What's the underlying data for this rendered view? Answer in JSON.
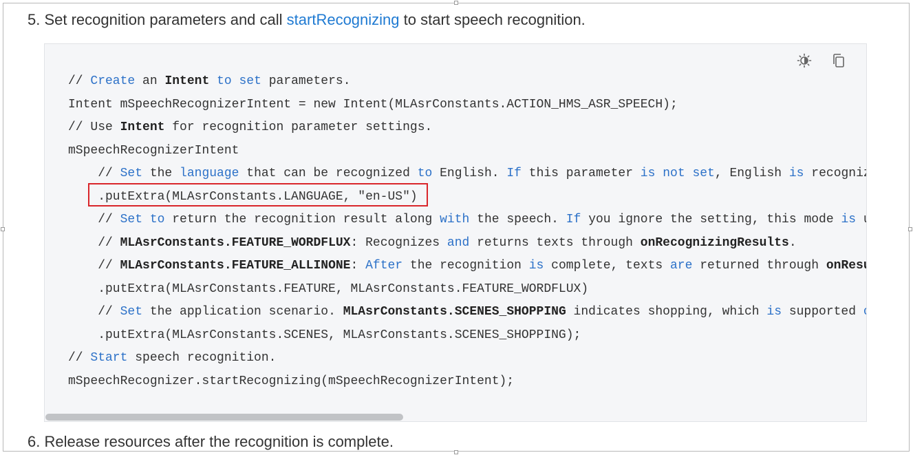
{
  "steps": {
    "step5": {
      "prefix": "5. Set recognition parameters and call ",
      "link": "startRecognizing",
      "suffix": " to start speech recognition."
    },
    "step6": "6. Release resources after the recognition is complete."
  },
  "code_block": {
    "toolbar": {
      "theme_icon": "theme-toggle-icon",
      "copy_icon": "copy-icon"
    },
    "lines": [
      [
        [
          "c",
          "// "
        ],
        [
          "k",
          "Create"
        ],
        [
          "c",
          " an "
        ],
        [
          "b",
          "Intent"
        ],
        [
          "c",
          " "
        ],
        [
          "k",
          "to"
        ],
        [
          "c",
          " "
        ],
        [
          "k",
          "set"
        ],
        [
          "c",
          " parameters."
        ]
      ],
      [
        [
          "n",
          "Intent mSpeechRecognizerIntent = new Intent(MLAsrConstants.ACTION_HMS_ASR_SPEECH);"
        ]
      ],
      [
        [
          "c",
          "// Use "
        ],
        [
          "b",
          "Intent"
        ],
        [
          "c",
          " for recognition parameter settings."
        ]
      ],
      [
        [
          "n",
          "mSpeechRecognizerIntent"
        ]
      ],
      [
        [
          "c",
          "    // "
        ],
        [
          "k",
          "Set"
        ],
        [
          "c",
          " the "
        ],
        [
          "k",
          "language"
        ],
        [
          "c",
          " that can be recognized "
        ],
        [
          "k",
          "to"
        ],
        [
          "c",
          " English. "
        ],
        [
          "k",
          "If"
        ],
        [
          "c",
          " this parameter "
        ],
        [
          "k",
          "is"
        ],
        [
          "c",
          " "
        ],
        [
          "k",
          "not"
        ],
        [
          "c",
          " "
        ],
        [
          "k",
          "set"
        ],
        [
          "c",
          ", English "
        ],
        [
          "k",
          "is"
        ],
        [
          "c",
          " recognized"
        ]
      ],
      [
        [
          "n",
          "    .putExtra(MLAsrConstants.LANGUAGE, \"en-US\")"
        ]
      ],
      [
        [
          "c",
          "    // "
        ],
        [
          "k",
          "Set"
        ],
        [
          "c",
          " "
        ],
        [
          "k",
          "to"
        ],
        [
          "c",
          " return the recognition result along "
        ],
        [
          "k",
          "with"
        ],
        [
          "c",
          " the speech. "
        ],
        [
          "k",
          "If"
        ],
        [
          "c",
          " you ignore the setting, this mode "
        ],
        [
          "k",
          "is"
        ],
        [
          "c",
          " used"
        ]
      ],
      [
        [
          "c",
          "    // "
        ],
        [
          "b",
          "MLAsrConstants.FEATURE_WORDFLUX"
        ],
        [
          "c",
          ": Recognizes "
        ],
        [
          "k",
          "and"
        ],
        [
          "c",
          " returns texts through "
        ],
        [
          "b",
          "onRecognizingResults"
        ],
        [
          "c",
          "."
        ]
      ],
      [
        [
          "c",
          "    // "
        ],
        [
          "b",
          "MLAsrConstants.FEATURE_ALLINONE"
        ],
        [
          "c",
          ": "
        ],
        [
          "k",
          "After"
        ],
        [
          "c",
          " the recognition "
        ],
        [
          "k",
          "is"
        ],
        [
          "c",
          " complete, texts "
        ],
        [
          "k",
          "are"
        ],
        [
          "c",
          " returned through "
        ],
        [
          "b",
          "onResults"
        ]
      ],
      [
        [
          "n",
          "    .putExtra(MLAsrConstants.FEATURE, MLAsrConstants.FEATURE_WORDFLUX)"
        ]
      ],
      [
        [
          "c",
          "    // "
        ],
        [
          "k",
          "Set"
        ],
        [
          "c",
          " the application scenario. "
        ],
        [
          "b",
          "MLAsrConstants.SCENES_SHOPPING"
        ],
        [
          "c",
          " indicates shopping, which "
        ],
        [
          "k",
          "is"
        ],
        [
          "c",
          " supported "
        ],
        [
          "k",
          "only"
        ]
      ],
      [
        [
          "n",
          "    .putExtra(MLAsrConstants.SCENES, MLAsrConstants.SCENES_SHOPPING);"
        ]
      ],
      [
        [
          "c",
          "// "
        ],
        [
          "k",
          "Start"
        ],
        [
          "c",
          " speech recognition."
        ]
      ],
      [
        [
          "n",
          "mSpeechRecognizer.startRecognizing(mSpeechRecognizerIntent);"
        ]
      ]
    ],
    "highlighted_line": 5,
    "colors": {
      "keyword": "#2c71c8",
      "highlight_border": "#d9252a",
      "link": "#1f7ad2",
      "background": "#f5f6f8"
    }
  }
}
